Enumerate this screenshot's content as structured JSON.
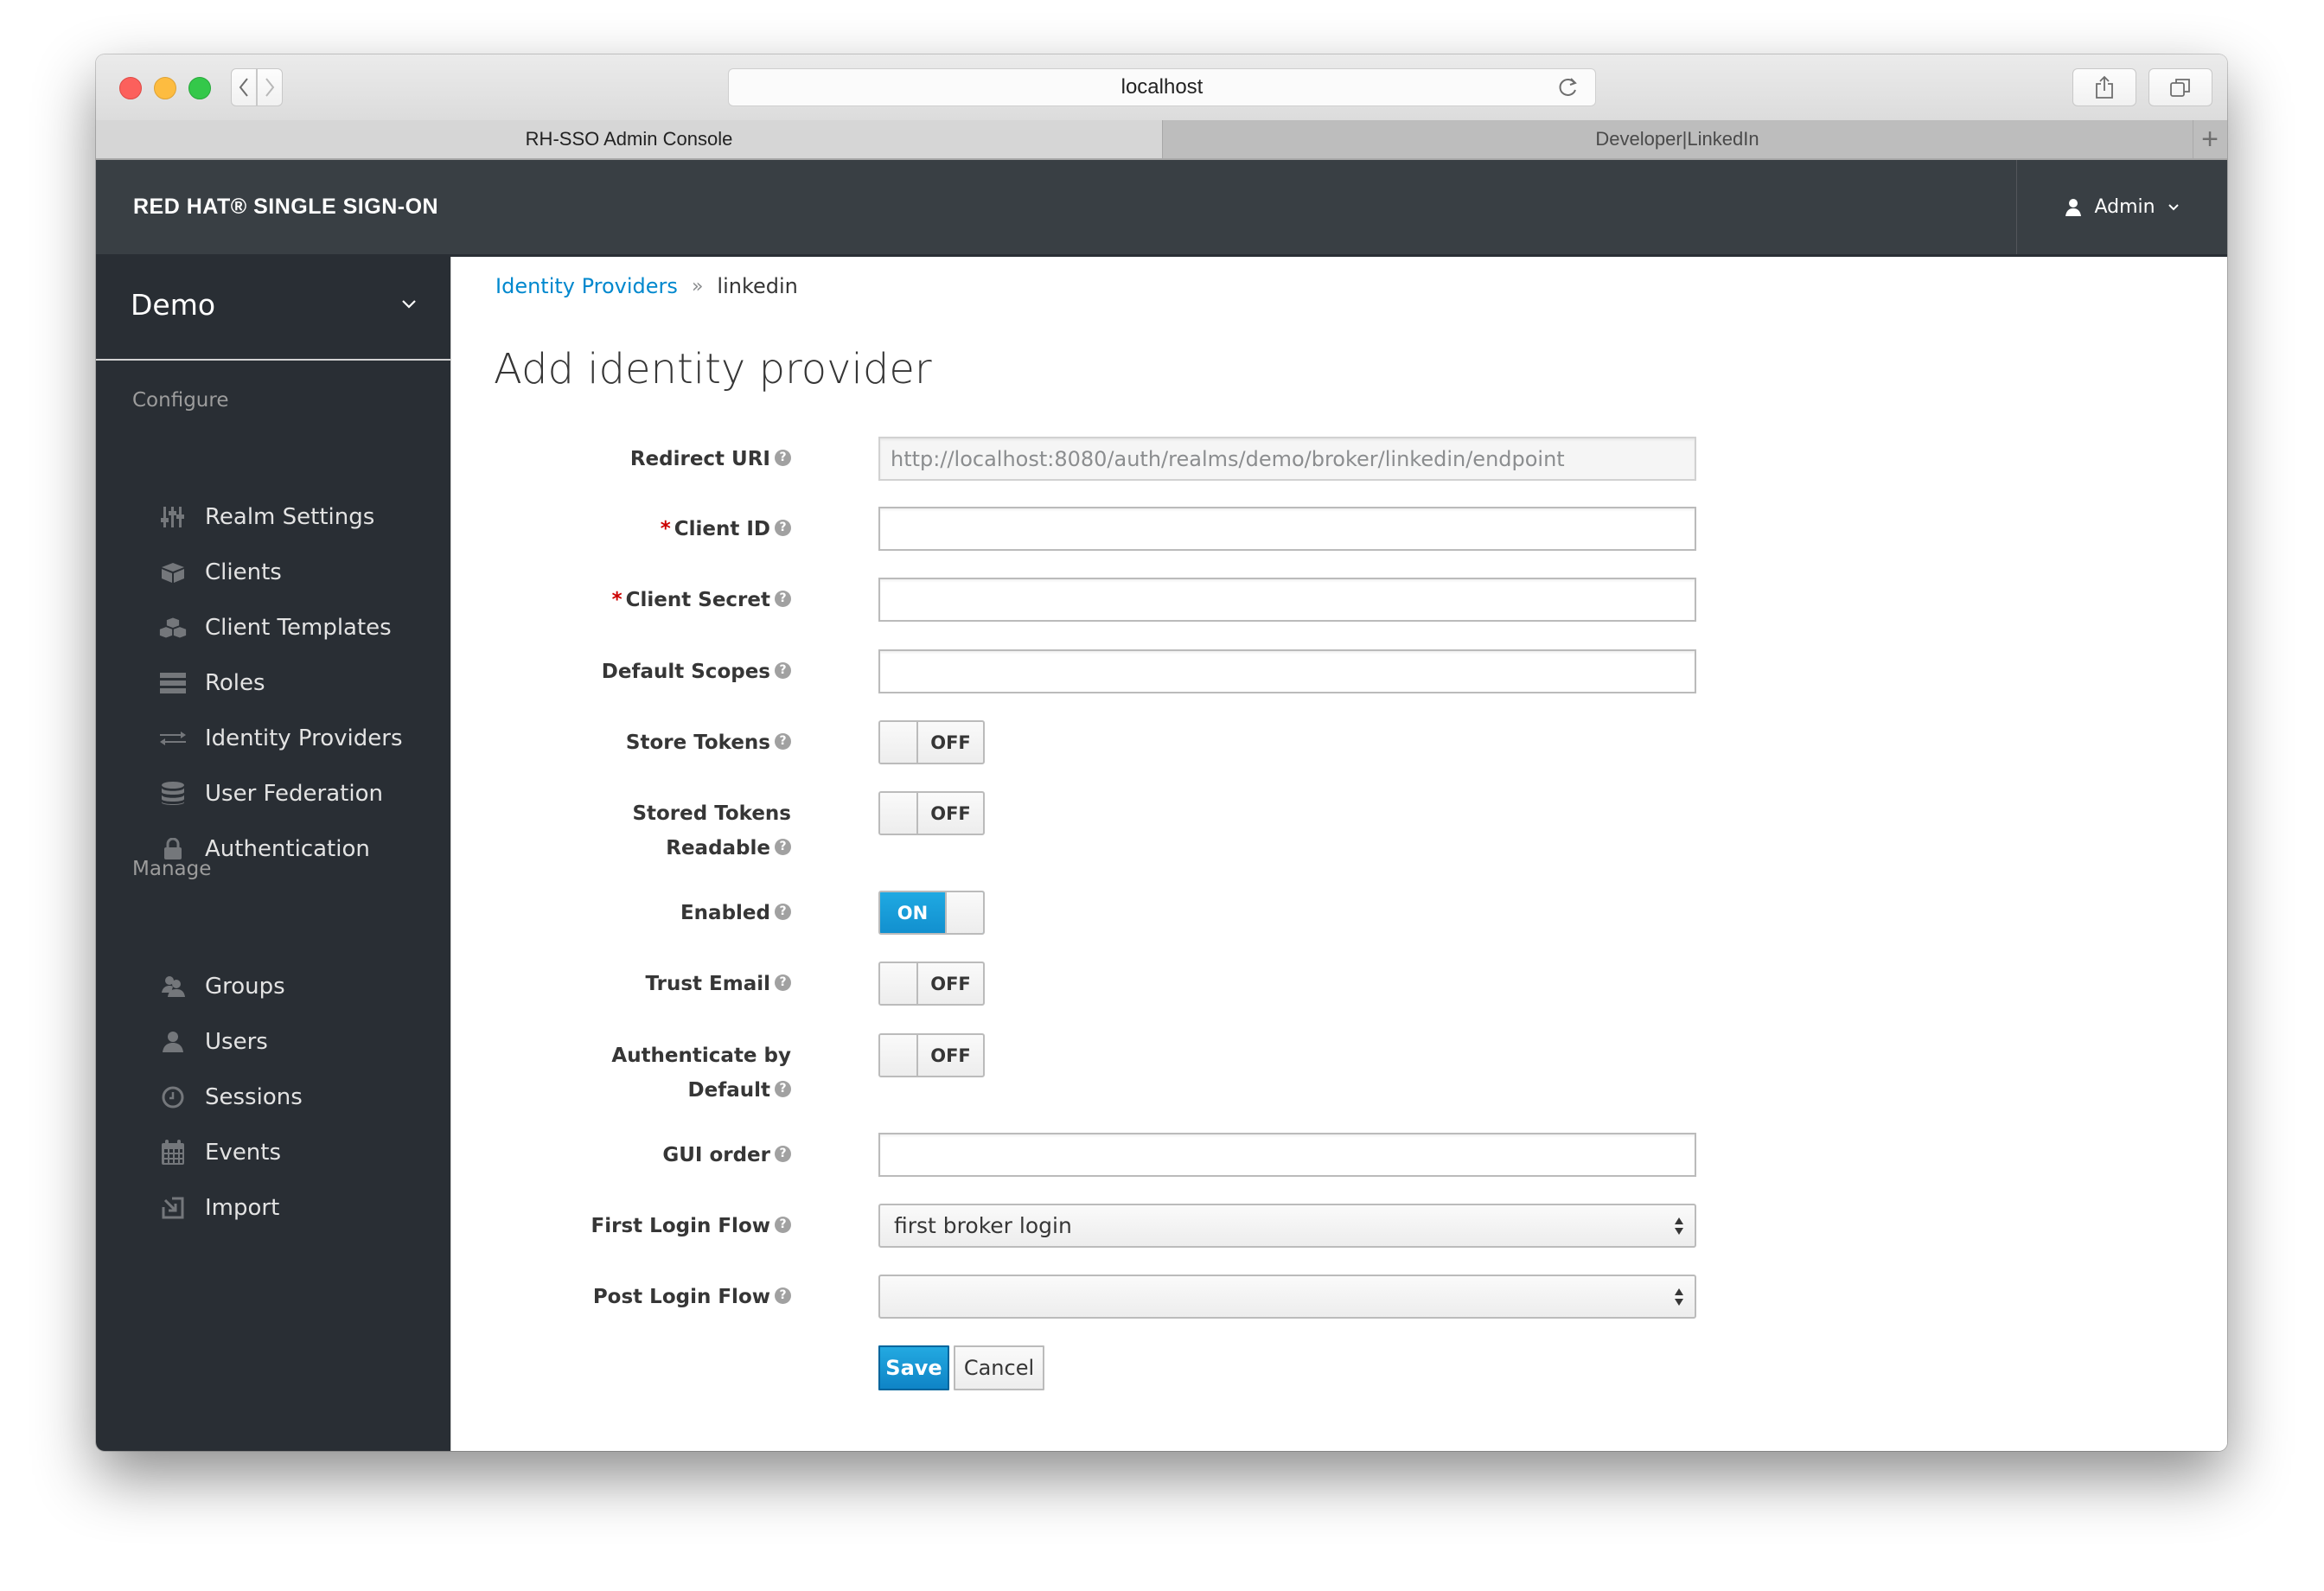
{
  "browser": {
    "address": "localhost",
    "tabs": [
      {
        "label": "RH-SSO Admin Console",
        "active": true
      },
      {
        "label": "Developer|LinkedIn",
        "active": false
      }
    ],
    "new_tab_label": "+"
  },
  "header": {
    "brand": "RED HAT® SINGLE SIGN-ON",
    "user": "Admin"
  },
  "sidebar": {
    "realm": "Demo",
    "sections": [
      {
        "title": "Configure",
        "items": [
          {
            "label": "Realm Settings",
            "icon": "sliders-icon"
          },
          {
            "label": "Clients",
            "icon": "cube-icon"
          },
          {
            "label": "Client Templates",
            "icon": "cubes-icon"
          },
          {
            "label": "Roles",
            "icon": "list-icon"
          },
          {
            "label": "Identity Providers",
            "icon": "exchange-icon"
          },
          {
            "label": "User Federation",
            "icon": "database-icon"
          },
          {
            "label": "Authentication",
            "icon": "lock-icon"
          }
        ]
      },
      {
        "title": "Manage",
        "items": [
          {
            "label": "Groups",
            "icon": "users-icon"
          },
          {
            "label": "Users",
            "icon": "user-icon"
          },
          {
            "label": "Sessions",
            "icon": "clock-icon"
          },
          {
            "label": "Events",
            "icon": "calendar-icon"
          },
          {
            "label": "Import",
            "icon": "import-icon"
          }
        ]
      }
    ]
  },
  "breadcrumb": {
    "parent": "Identity Providers",
    "separator": "»",
    "current": "linkedin"
  },
  "page_title": "Add identity provider",
  "form": {
    "redirect_uri": {
      "label": "Redirect URI",
      "value": "http://localhost:8080/auth/realms/demo/broker/linkedin/endpoint"
    },
    "client_id": {
      "label": "Client ID",
      "required": true,
      "value": ""
    },
    "client_secret": {
      "label": "Client Secret",
      "required": true,
      "value": ""
    },
    "default_scopes": {
      "label": "Default Scopes",
      "value": ""
    },
    "store_tokens": {
      "label": "Store Tokens",
      "state": "OFF"
    },
    "stored_tokens_readable": {
      "label_line1": "Stored Tokens",
      "label_line2": "Readable",
      "state": "OFF"
    },
    "enabled": {
      "label": "Enabled",
      "state": "ON"
    },
    "trust_email": {
      "label": "Trust Email",
      "state": "OFF"
    },
    "authenticate_by_default": {
      "label_line1": "Authenticate by",
      "label_line2": "Default",
      "state": "OFF"
    },
    "gui_order": {
      "label": "GUI order",
      "value": ""
    },
    "first_login_flow": {
      "label": "First Login Flow",
      "value": "first broker login"
    },
    "post_login_flow": {
      "label": "Post Login Flow",
      "value": ""
    },
    "required_marker": "*",
    "help_glyph": "?",
    "save_label": "Save",
    "cancel_label": "Cancel"
  },
  "colors": {
    "accent": "#0088ce",
    "toggle_on": "#1ba3dc",
    "header_bg": "#393f44",
    "sidebar_bg": "#292e34",
    "required": "#cc0000"
  }
}
